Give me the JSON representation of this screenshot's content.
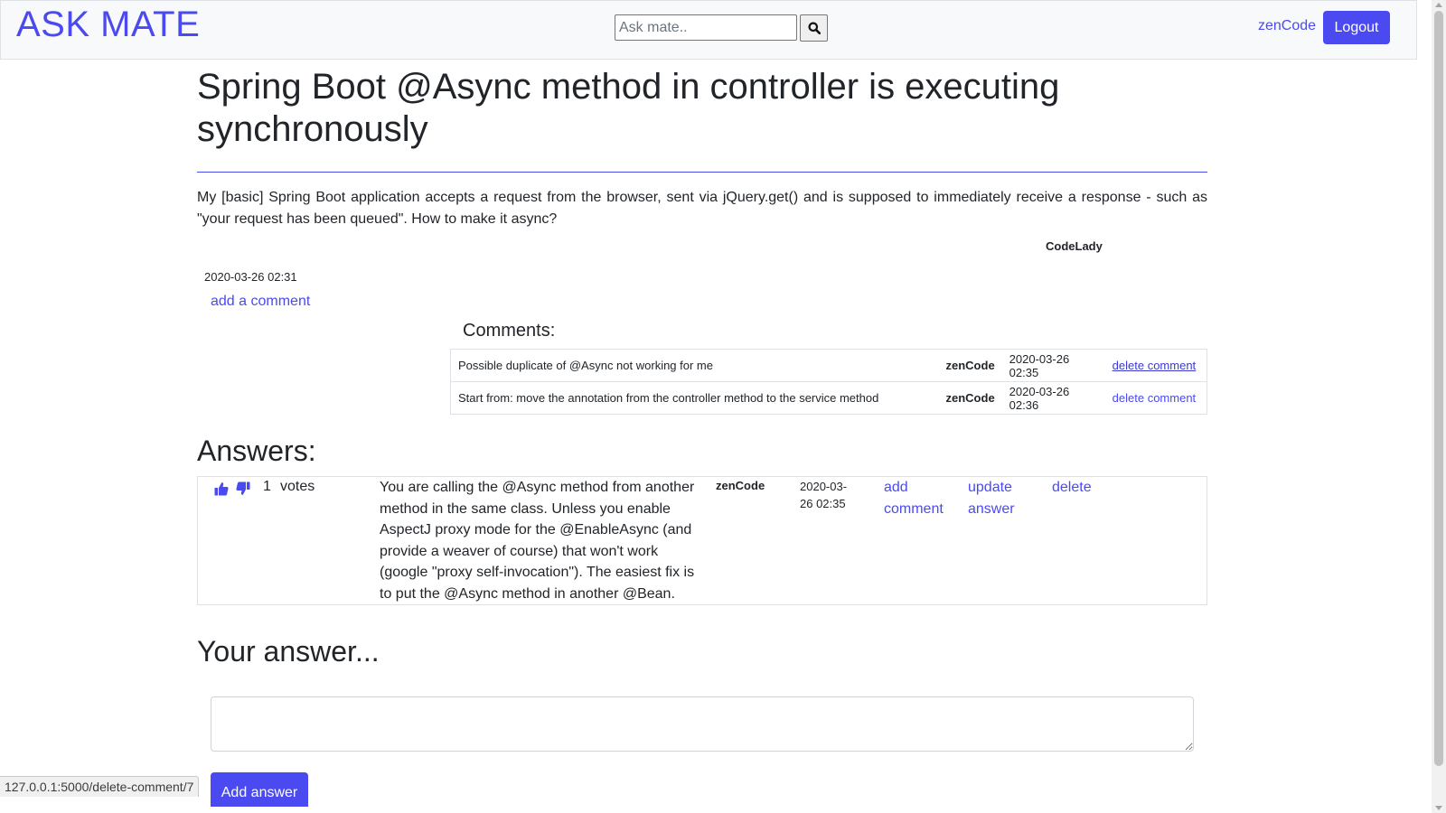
{
  "navbar": {
    "brand": "ASK MATE",
    "search_placeholder": "Ask mate..",
    "user": "zenCode",
    "logout_label": "Logout"
  },
  "question": {
    "title": "Spring Boot @Async method in controller is executing synchronously",
    "body": "My [basic] Spring Boot application accepts a request from the browser, sent via jQuery.get() and is supposed to immediately receive a response - such as \"your request has been queued\". How to make it async?",
    "author": "CodeLady",
    "date": "2020-03-26 02:31",
    "add_comment_label": "add a comment"
  },
  "comments": {
    "heading": "Comments:",
    "items": [
      {
        "text": "Possible duplicate of @Async not working for me",
        "user": "zenCode",
        "date": "2020-03-26 02:35",
        "action": "delete comment"
      },
      {
        "text": "Start from: move the annotation from the controller method to the service method",
        "user": "zenCode",
        "date": "2020-03-26 02:36",
        "action": "delete comment"
      }
    ]
  },
  "answers": {
    "heading": "Answers:",
    "items": [
      {
        "votes": "1",
        "votes_label": "votes",
        "text": "You are calling the @Async method from another method in the same class. Unless you enable AspectJ proxy mode for the @EnableAsync (and provide a weaver of course) that won't work (google \"proxy self-invocation\"). The easiest fix is to put the @Async method in another @Bean.",
        "user": "zenCode",
        "date": "2020-03-26 02:35",
        "add_comment_label": "add comment",
        "update_label": "update answer",
        "delete_label": "delete"
      }
    ]
  },
  "your_answer": {
    "heading": "Your answer...",
    "textarea_value": "",
    "submit_label": "Add answer"
  },
  "status_bar": {
    "url": "127.0.0.1:5000/delete-comment/7"
  },
  "icons": {
    "search": "search-icon",
    "thumbs_up": "thumbs-up-icon",
    "thumbs_down": "thumbs-down-icon"
  },
  "colors": {
    "accent": "#4a4af0",
    "navbar_bg": "#f8f9fa",
    "text": "#212529"
  }
}
